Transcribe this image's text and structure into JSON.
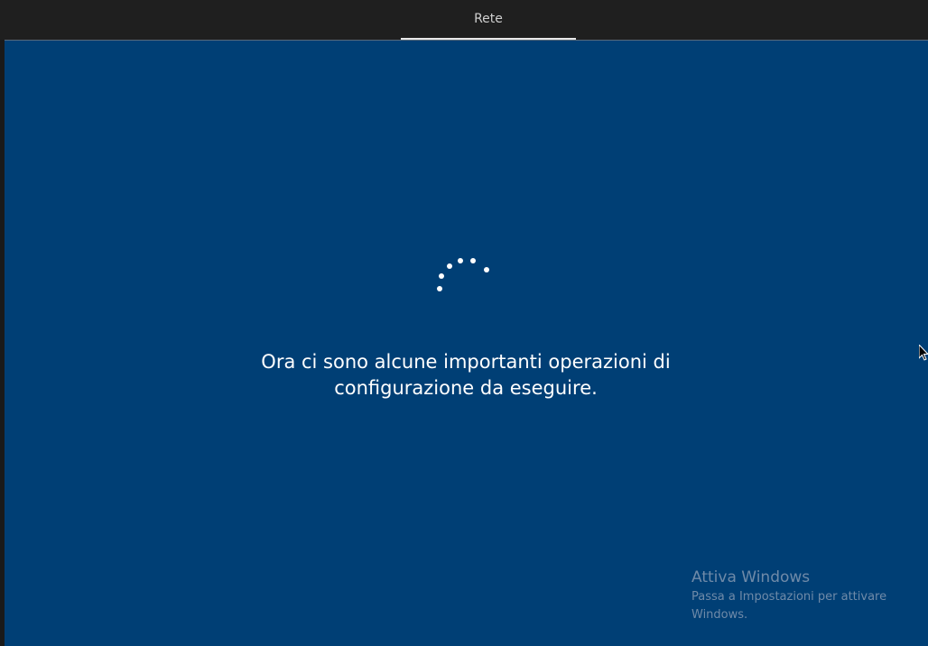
{
  "header": {
    "tab_label": "Rete"
  },
  "main": {
    "message": "Ora ci sono alcune importanti operazioni di configurazione da eseguire.",
    "spinner_icon": "loading-spinner-icon"
  },
  "watermark": {
    "title": "Attiva Windows",
    "text": "Passa a Impostazioni per attivare Windows."
  },
  "colors": {
    "background": "#003f75",
    "topbar": "#1f1f1f",
    "text": "#ffffff",
    "watermark": "#6f8aa8"
  }
}
